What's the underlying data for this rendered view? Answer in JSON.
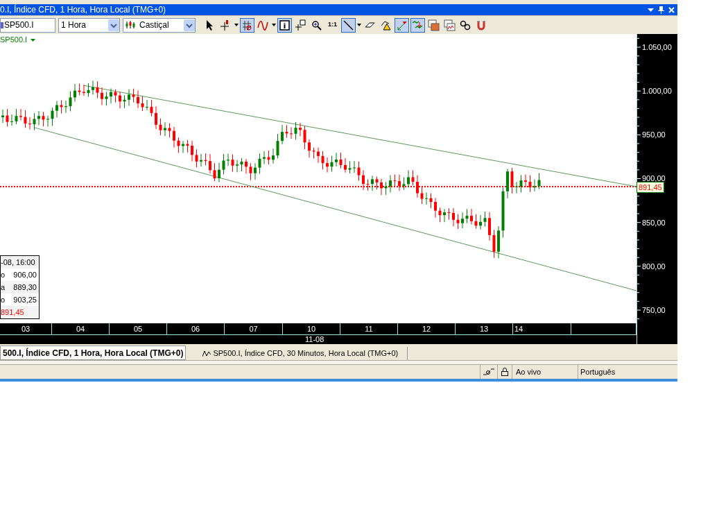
{
  "window": {
    "title": "0.I, Índice CFD, 1 Hora, Hora Local (TMG+0)"
  },
  "toolbar": {
    "symbol": "SP500.I",
    "period": "1 Hora",
    "chart_type": "Castiçal",
    "tools": [
      {
        "kind": "pointer",
        "selected": false
      },
      {
        "kind": "crosshair",
        "selected": false
      },
      {
        "kind": "grid",
        "selected": true
      },
      {
        "kind": "indicator",
        "selected": false
      },
      {
        "kind": "info",
        "selected": true
      },
      {
        "kind": "annotate",
        "selected": false
      },
      {
        "kind": "zoom",
        "selected": false
      },
      {
        "kind": "ratio",
        "label": "1:1",
        "selected": false
      },
      {
        "kind": "line",
        "selected": true
      },
      {
        "kind": "eraser",
        "selected": false
      },
      {
        "kind": "alert",
        "selected": false
      },
      {
        "kind": "autoscale",
        "selected": true
      },
      {
        "kind": "trades",
        "selected": true
      },
      {
        "kind": "template",
        "selected": false
      },
      {
        "kind": "compare",
        "selected": false
      },
      {
        "kind": "link",
        "selected": false
      },
      {
        "kind": "magnet",
        "selected": false
      }
    ]
  },
  "chart": {
    "legend": "SP500.I",
    "price_labels": [
      "1.050,00",
      "1.000,00",
      "950,00",
      "900,00",
      "850,00",
      "800,00",
      "750,00"
    ],
    "last_price": "891,45",
    "info_box": [
      {
        "value": "-08, 16:00"
      },
      {
        "label": "o",
        "value": "906,00"
      },
      {
        "label": "a",
        "value": "889,30"
      },
      {
        "label": "o",
        "value": "903,25"
      },
      {
        "value": "891,45",
        "kind": "last"
      }
    ],
    "date_labels": [
      "03",
      "04",
      "05",
      "06",
      "07",
      "10",
      "11",
      "12",
      "13",
      "14"
    ],
    "month_label": "11-08"
  },
  "tabs": [
    {
      "label": "500.I, Índice CFD, 1 Hora, Hora Local (TMG+0)",
      "selected": true
    },
    {
      "label": "SP500.I, Índice CFD, 30 Minutos, Hora Local (TMG+0)",
      "selected": false
    }
  ],
  "status_bar": {
    "mode": "Ao vivo",
    "language": "Português"
  }
}
